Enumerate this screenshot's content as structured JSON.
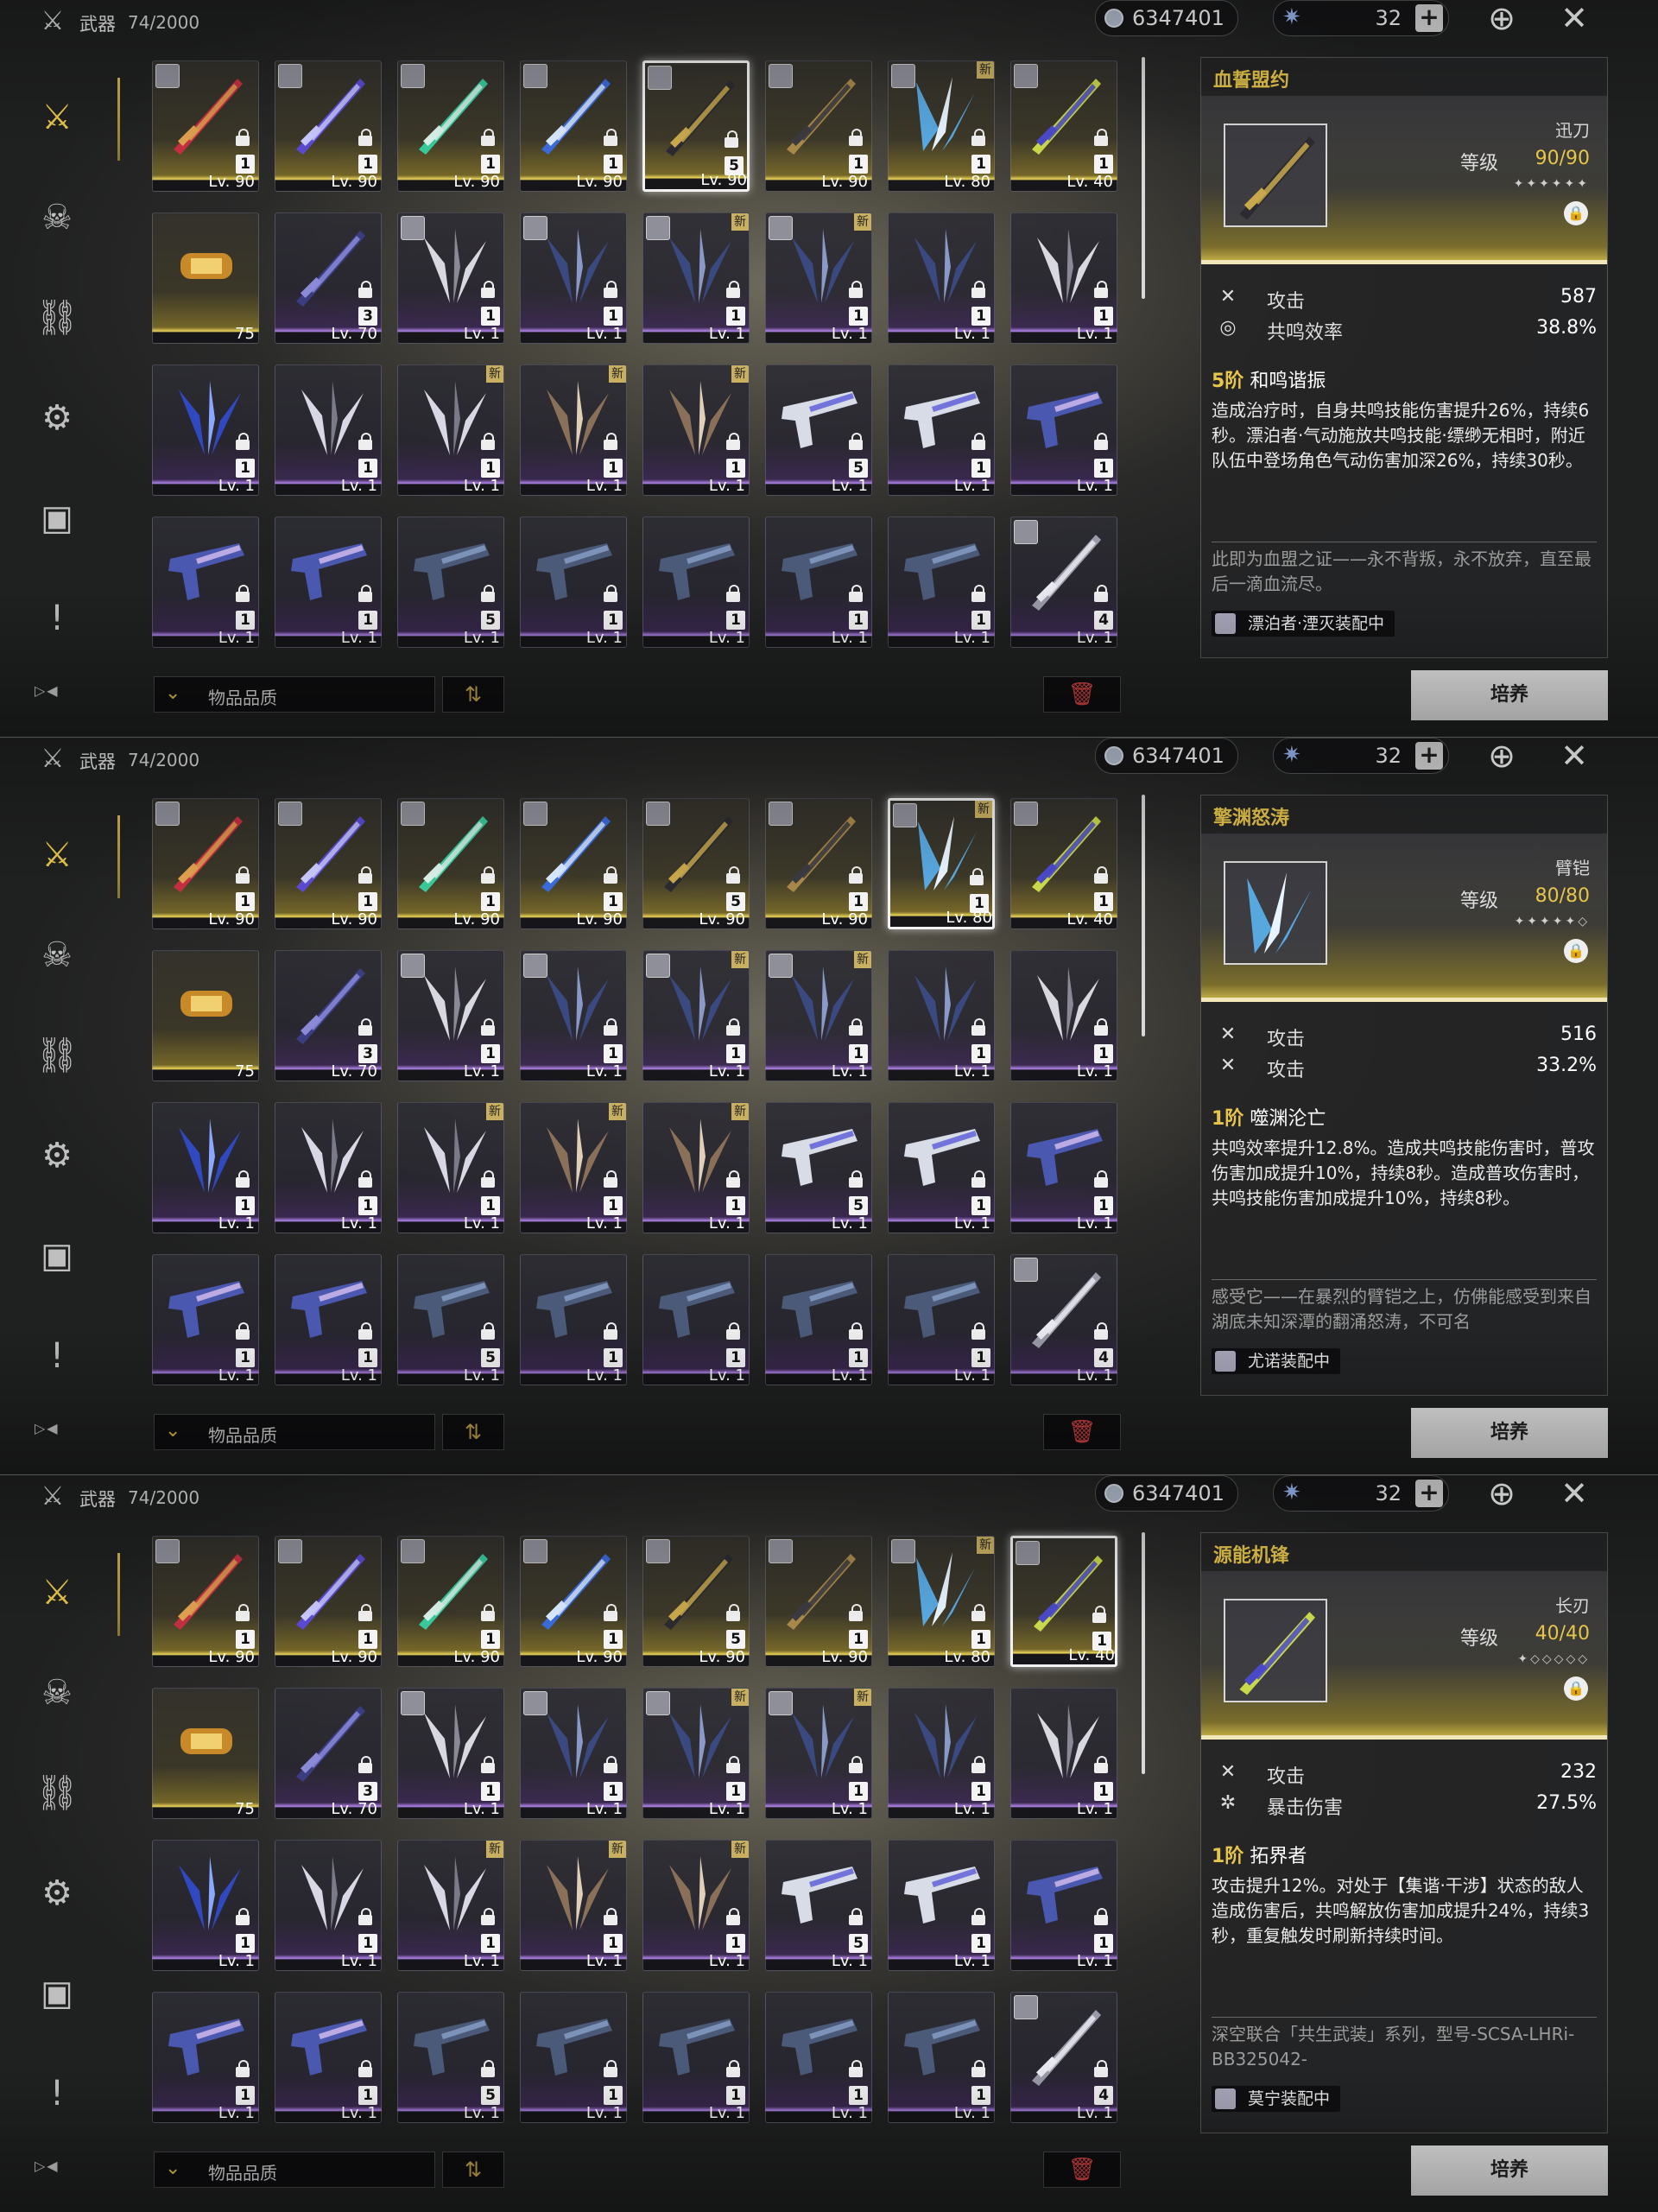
{
  "header": {
    "title": "武器",
    "count": "74/2000",
    "currency": "6347401",
    "stamina": "32",
    "plus": "+"
  },
  "sidebar": {
    "items": [
      "weapon-icon",
      "echo-icon",
      "material-icon",
      "resource-icon",
      "box-icon",
      "quest-icon"
    ],
    "bottom": "▷◀"
  },
  "sort": {
    "label": "物品品质",
    "chevron": "⌄",
    "order_icon": "⇅",
    "trash_icon": "🗑"
  },
  "develop_label": "培养",
  "colors": {
    "gold": "#e6c54a",
    "purple": "#be8cff",
    "trash": "#e04444"
  },
  "grid": {
    "rows": [
      [
        {
          "lv": "Lv. 90",
          "rank": "1",
          "portrait": true,
          "rarity": "gold",
          "weapon": "crimson-sword"
        },
        {
          "lv": "Lv. 90",
          "rank": "1",
          "portrait": true,
          "rarity": "gold",
          "weapon": "violet-blade"
        },
        {
          "lv": "Lv. 90",
          "rank": "1",
          "portrait": true,
          "rarity": "gold",
          "weapon": "jade-rifle"
        },
        {
          "lv": "Lv. 90",
          "rank": "1",
          "portrait": true,
          "rarity": "gold",
          "weapon": "azure-spear"
        },
        {
          "lv": "Lv. 90",
          "rank": "5",
          "portrait": true,
          "rarity": "gold",
          "weapon": "dark-sword"
        },
        {
          "lv": "Lv. 90",
          "rank": "1",
          "portrait": true,
          "rarity": "gold",
          "weapon": "gold-blade"
        },
        {
          "lv": "Lv. 80",
          "rank": "1",
          "portrait": true,
          "rarity": "gold",
          "weapon": "ice-gauntlet",
          "new": true
        },
        {
          "lv": "Lv. 40",
          "rank": "1",
          "portrait": true,
          "rarity": "gold",
          "weapon": "neon-blade"
        }
      ],
      [
        {
          "lv": "75",
          "rank": "",
          "portrait": false,
          "rarity": "gold",
          "weapon": "gold-capsule"
        },
        {
          "lv": "Lv. 70",
          "rank": "3",
          "portrait": false,
          "rarity": "purple",
          "weapon": "cross-sword"
        },
        {
          "lv": "Lv. 1",
          "rank": "1",
          "portrait": true,
          "rarity": "purple",
          "weapon": "silver-fan"
        },
        {
          "lv": "Lv. 1",
          "rank": "1",
          "portrait": true,
          "rarity": "purple",
          "weapon": "dark-fan"
        },
        {
          "lv": "Lv. 1",
          "rank": "1",
          "portrait": true,
          "rarity": "purple",
          "weapon": "dark-fan",
          "new": true
        },
        {
          "lv": "Lv. 1",
          "rank": "1",
          "portrait": true,
          "rarity": "purple",
          "weapon": "dark-fan",
          "new": true
        },
        {
          "lv": "Lv. 1",
          "rank": "1",
          "portrait": false,
          "rarity": "purple",
          "weapon": "dark-fan"
        },
        {
          "lv": "Lv. 1",
          "rank": "1",
          "portrait": false,
          "rarity": "purple",
          "weapon": "silver-fan"
        }
      ],
      [
        {
          "lv": "Lv. 1",
          "rank": "1",
          "portrait": false,
          "rarity": "purple",
          "weapon": "blue-claw"
        },
        {
          "lv": "Lv. 1",
          "rank": "1",
          "portrait": false,
          "rarity": "purple",
          "weapon": "white-claw"
        },
        {
          "lv": "Lv. 1",
          "rank": "1",
          "portrait": false,
          "rarity": "purple",
          "weapon": "white-claw",
          "new": true
        },
        {
          "lv": "Lv. 1",
          "rank": "1",
          "portrait": false,
          "rarity": "purple",
          "weapon": "bronze-claw",
          "new": true
        },
        {
          "lv": "Lv. 1",
          "rank": "1",
          "portrait": false,
          "rarity": "purple",
          "weapon": "bronze-claw",
          "new": true
        },
        {
          "lv": "Lv. 1",
          "rank": "5",
          "portrait": false,
          "rarity": "purple",
          "weapon": "white-pistol"
        },
        {
          "lv": "Lv. 1",
          "rank": "1",
          "portrait": false,
          "rarity": "purple",
          "weapon": "white-pistol"
        },
        {
          "lv": "Lv. 1",
          "rank": "1",
          "portrait": false,
          "rarity": "purple",
          "weapon": "blue-pistol"
        }
      ],
      [
        {
          "lv": "Lv. 1",
          "rank": "1",
          "portrait": false,
          "rarity": "purple",
          "weapon": "blue-pistol"
        },
        {
          "lv": "Lv. 1",
          "rank": "1",
          "portrait": false,
          "rarity": "purple",
          "weapon": "blue-pistol"
        },
        {
          "lv": "Lv. 1",
          "rank": "5",
          "portrait": false,
          "rarity": "purple",
          "weapon": "steel-pistol"
        },
        {
          "lv": "Lv. 1",
          "rank": "1",
          "portrait": false,
          "rarity": "purple",
          "weapon": "steel-pistol"
        },
        {
          "lv": "Lv. 1",
          "rank": "1",
          "portrait": false,
          "rarity": "purple",
          "weapon": "steel-pistol"
        },
        {
          "lv": "Lv. 1",
          "rank": "1",
          "portrait": false,
          "rarity": "purple",
          "weapon": "steel-pistol"
        },
        {
          "lv": "Lv. 1",
          "rank": "1",
          "portrait": false,
          "rarity": "purple",
          "weapon": "steel-pistol"
        },
        {
          "lv": "Lv. 1",
          "rank": "4",
          "portrait": true,
          "rarity": "purple",
          "weapon": "long-blade"
        }
      ]
    ]
  },
  "panels": [
    {
      "selected": [
        0,
        4
      ],
      "detail": {
        "name": "血誓盟约",
        "type": "迅刀",
        "level_label": "等级",
        "level": "90/90",
        "stars": "✦✦✦✦✦✦",
        "stats": [
          {
            "icon": "✕",
            "name": "攻击",
            "value": "587"
          },
          {
            "icon": "◎",
            "name": "共鸣效率",
            "value": "38.8%"
          }
        ],
        "skill_level": "5阶",
        "skill_name": "和鸣谐振",
        "skill_desc": "造成治疗时，自身共鸣技能伤害提升26%，持续6秒。漂泊者·气动施放共鸣技能·缥缈无相时，附近队伍中登场角色气动伤害加深26%，持续30秒。",
        "flavor": "此即为血盟之证——永不背叛，永不放弃，直至最后一滴血流尽。",
        "equipped": "漂泊者·湮灭装配中"
      }
    },
    {
      "selected": [
        0,
        6
      ],
      "detail": {
        "name": "擎渊怒涛",
        "type": "臂铠",
        "level_label": "等级",
        "level": "80/80",
        "stars": "✦✦✦✦✦◇",
        "stats": [
          {
            "icon": "✕",
            "name": "攻击",
            "value": "516"
          },
          {
            "icon": "✕",
            "name": "攻击",
            "value": "33.2%"
          }
        ],
        "skill_level": "1阶",
        "skill_name": "噬渊沦亡",
        "skill_desc": "共鸣效率提升12.8%。造成共鸣技能伤害时，普攻伤害加成提升10%，持续8秒。造成普攻伤害时，共鸣技能伤害加成提升10%，持续8秒。",
        "flavor": "感受它——在暴烈的臂铠之上，仿佛能感受到来自湖底未知深潭的翻涌怒涛，不可名",
        "equipped": "尤诺装配中"
      }
    },
    {
      "selected": [
        0,
        7
      ],
      "detail": {
        "name": "源能机锋",
        "type": "长刃",
        "level_label": "等级",
        "level": "40/40",
        "stars": "✦◇◇◇◇◇",
        "stats": [
          {
            "icon": "✕",
            "name": "攻击",
            "value": "232"
          },
          {
            "icon": "✲",
            "name": "暴击伤害",
            "value": "27.5%"
          }
        ],
        "skill_level": "1阶",
        "skill_name": "拓界者",
        "skill_desc": "攻击提升12%。对处于【集谐·干涉】状态的敌人造成伤害后，共鸣解放伤害加成提升24%，持续3秒，重复触发时刷新持续时间。",
        "flavor": "深空联合「共生武装」系列，型号-SCSA-LHRi-BB325042-",
        "equipped": "莫宁装配中"
      }
    }
  ]
}
